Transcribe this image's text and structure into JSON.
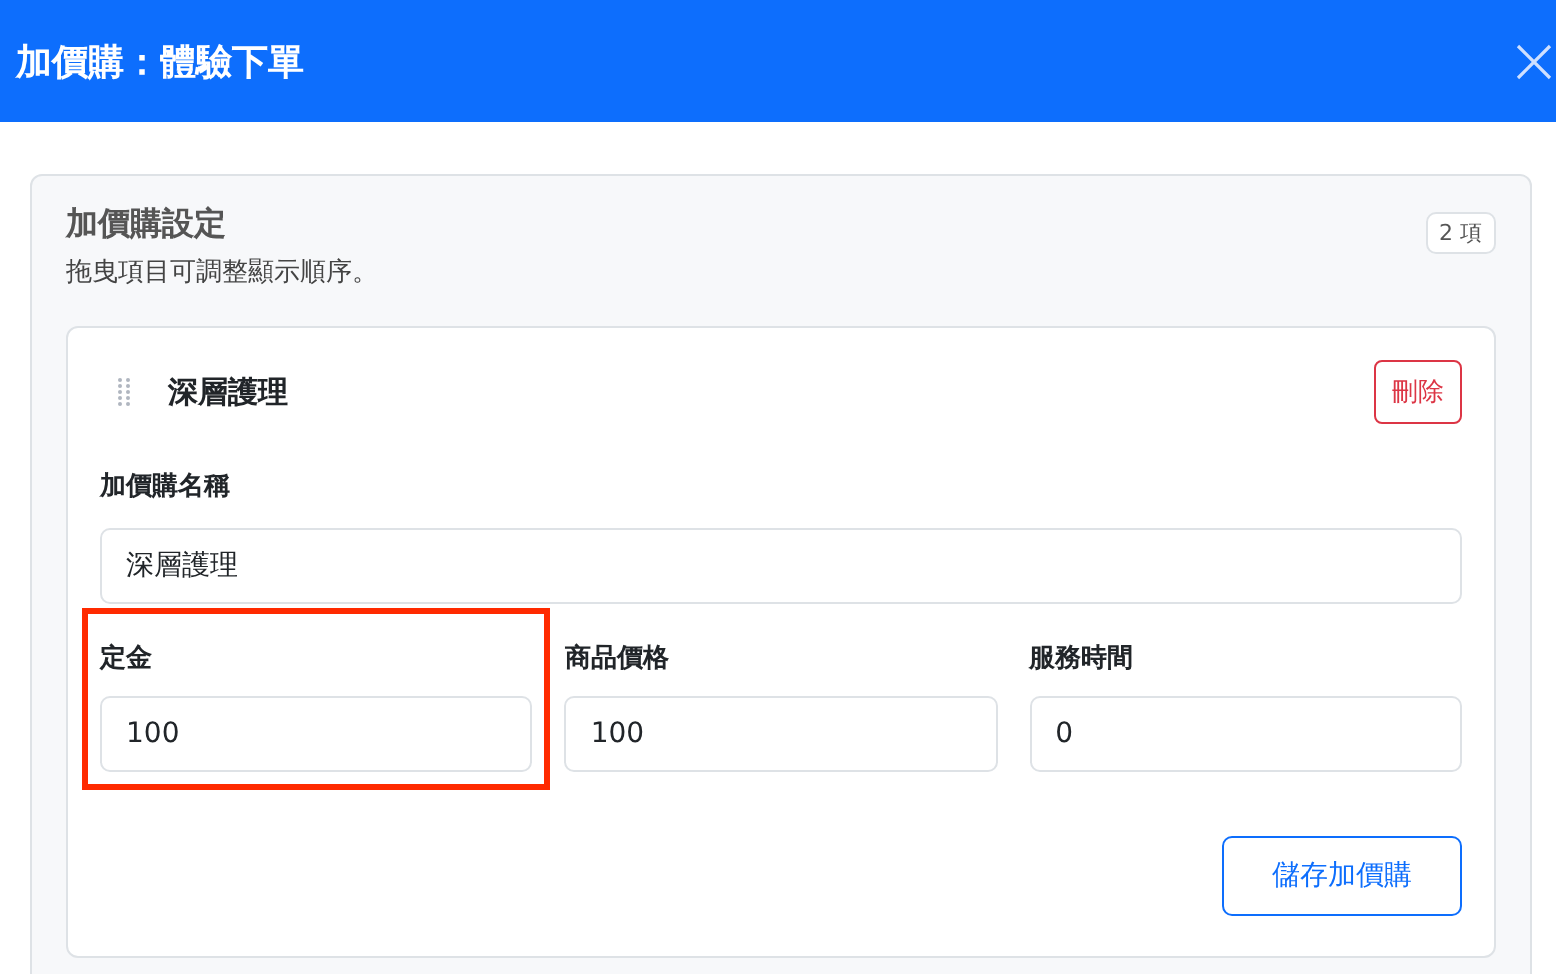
{
  "dialog": {
    "title": "加價購：體驗下單"
  },
  "section": {
    "title": "加價購設定",
    "hint": "拖曳項目可調整顯示順序。",
    "count": "2 項"
  },
  "item": {
    "name": "深層護理",
    "delete_label": "刪除",
    "name_field": {
      "label": "加價購名稱",
      "value": "深層護理"
    },
    "fields": [
      {
        "label": "定金",
        "value": "100",
        "highlighted": true
      },
      {
        "label": "商品價格",
        "value": "100",
        "highlighted": false
      },
      {
        "label": "服務時間",
        "value": "0",
        "highlighted": false
      }
    ],
    "save_label": "儲存加價購"
  }
}
